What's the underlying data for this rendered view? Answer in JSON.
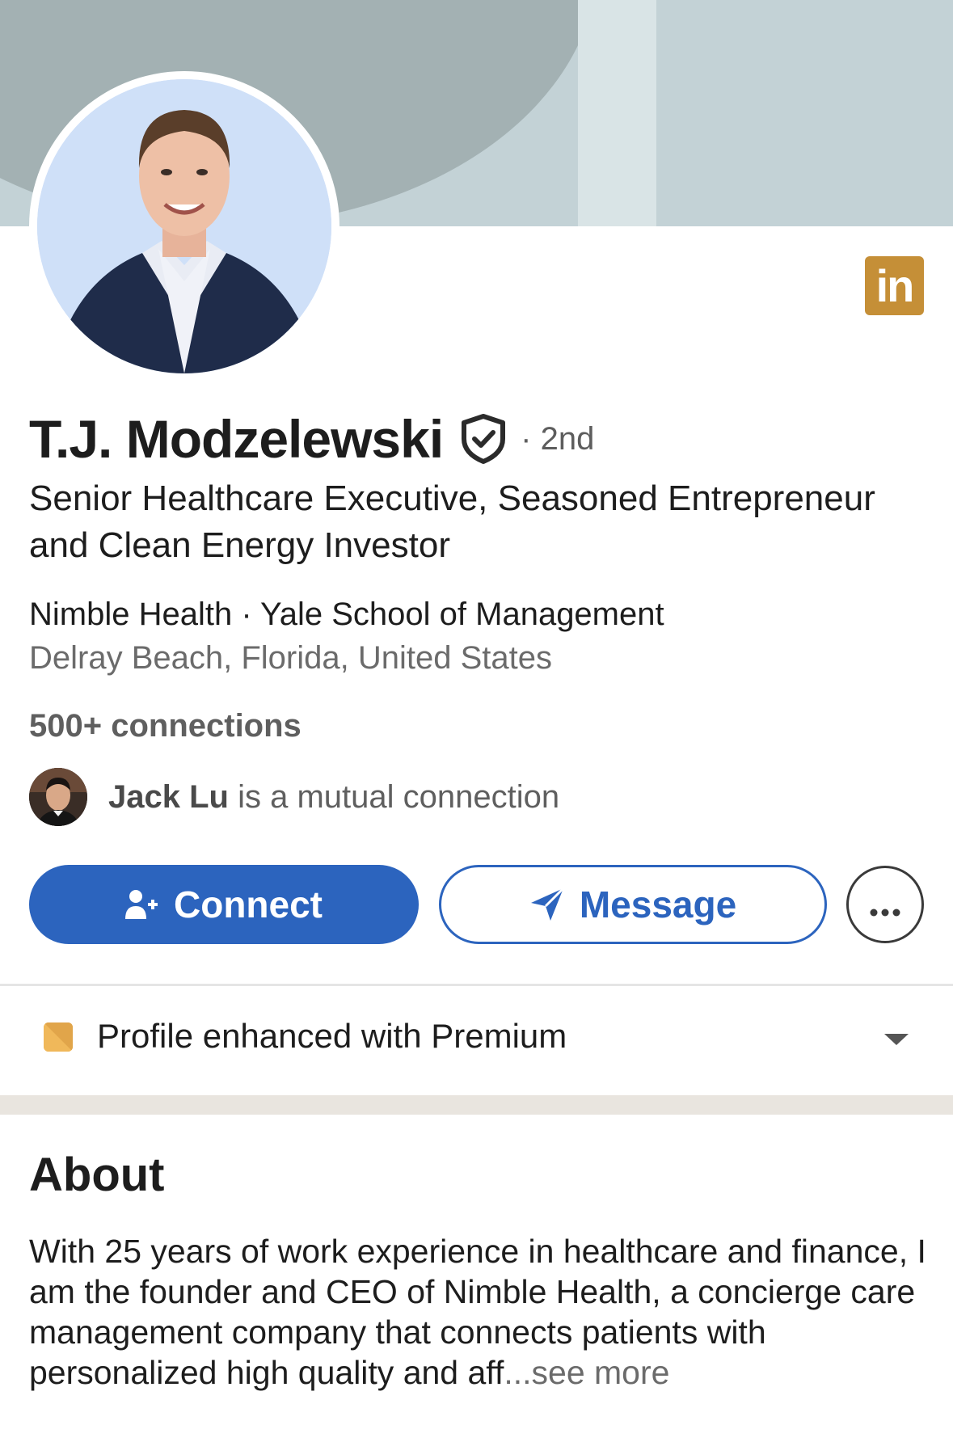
{
  "profile": {
    "name": "T.J. Modzelewski",
    "degree": "· 2nd",
    "headline": "Senior Healthcare Executive, Seasoned Entrepreneur and Clean Energy Investor",
    "org_line": "Nimble Health · Yale School of Management",
    "location": "Delray Beach, Florida, United States",
    "connections": "500+ connections",
    "mutual_name": "Jack Lu",
    "mutual_suffix": " is a mutual connection"
  },
  "badge": {
    "label": "in",
    "color": "#c58f37"
  },
  "actions": {
    "connect_label": "Connect",
    "message_label": "Message",
    "more_label": "•••"
  },
  "premium": {
    "label": "Profile enhanced with Premium"
  },
  "about": {
    "title": "About",
    "text": "With 25 years of work experience in healthcare and finance, I am the founder and CEO of Nimble Health, a concierge care management company that connects patients with personalized high quality and aff",
    "truncation": "...",
    "see_more": "see more"
  },
  "colors": {
    "accent": "#2c64be",
    "banner": "#a3b1b3",
    "premium": "#f0b85a"
  },
  "icons": [
    "verified-shield-icon",
    "add-person-icon",
    "send-paper-plane-icon",
    "more-dots-icon",
    "premium-icon",
    "caret-down-icon",
    "linkedin-logo"
  ]
}
